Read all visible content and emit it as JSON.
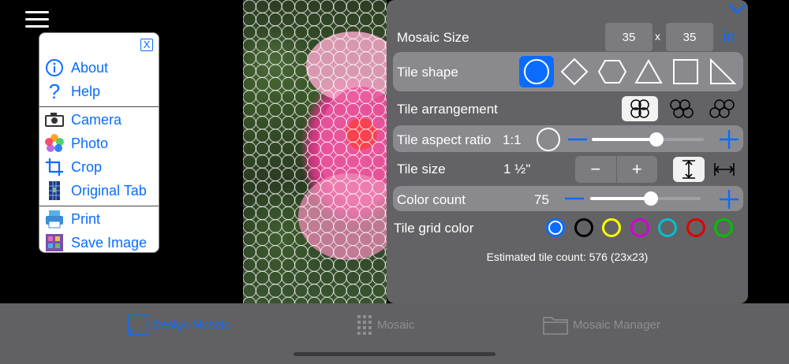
{
  "menu": {
    "close_label": "X",
    "items": [
      {
        "label": "About",
        "icon": "info-icon"
      },
      {
        "label": "Help",
        "icon": "question-icon"
      },
      {
        "label": "Camera",
        "icon": "camera-icon"
      },
      {
        "label": "Photo",
        "icon": "photos-icon"
      },
      {
        "label": "Crop",
        "icon": "crop-icon"
      },
      {
        "label": "Original Tab",
        "icon": "original-tab-icon"
      },
      {
        "label": "Print",
        "icon": "printer-icon"
      },
      {
        "label": "Save Image",
        "icon": "save-image-icon"
      }
    ]
  },
  "panel": {
    "mosaic_size": {
      "label": "Mosaic Size",
      "width": "35",
      "separator": "x",
      "height": "35",
      "unit": "in"
    },
    "tile_shape": {
      "label": "Tile shape",
      "options": [
        "circle",
        "diamond",
        "hexagon",
        "triangle",
        "square",
        "right-triangle"
      ],
      "selected": "circle"
    },
    "tile_arrangement": {
      "label": "Tile arrangement",
      "options": [
        "grid",
        "offset",
        "hex"
      ],
      "selected": "grid"
    },
    "tile_aspect_ratio": {
      "label": "Tile aspect ratio",
      "value": "1:1",
      "level": 0.58
    },
    "tile_size": {
      "label": "Tile size",
      "value": "1 ½\"",
      "minus": "−",
      "plus": "+"
    },
    "color_count": {
      "label": "Color count",
      "value": "75",
      "level": 0.55
    },
    "tile_grid_color": {
      "label": "Tile grid color",
      "colors": [
        "#0a6cff",
        "#000000",
        "#ffff00",
        "#d400d4",
        "#00c0d0",
        "#e00000",
        "#00c000"
      ],
      "selected": "#0a6cff"
    },
    "estimate": "Estimated tile count: 576 (23x23)"
  },
  "tabs": [
    {
      "label": "Design Mosaic",
      "icon": "design-mosaic-icon",
      "active": true
    },
    {
      "label": "Mosaic",
      "icon": "mosaic-grid-icon",
      "active": false
    },
    {
      "label": "Mosaic Manager",
      "icon": "folder-icon",
      "active": false
    }
  ],
  "colors": {
    "accent": "#0a6cff",
    "panel": "#636366",
    "tabbar": "#616163"
  }
}
